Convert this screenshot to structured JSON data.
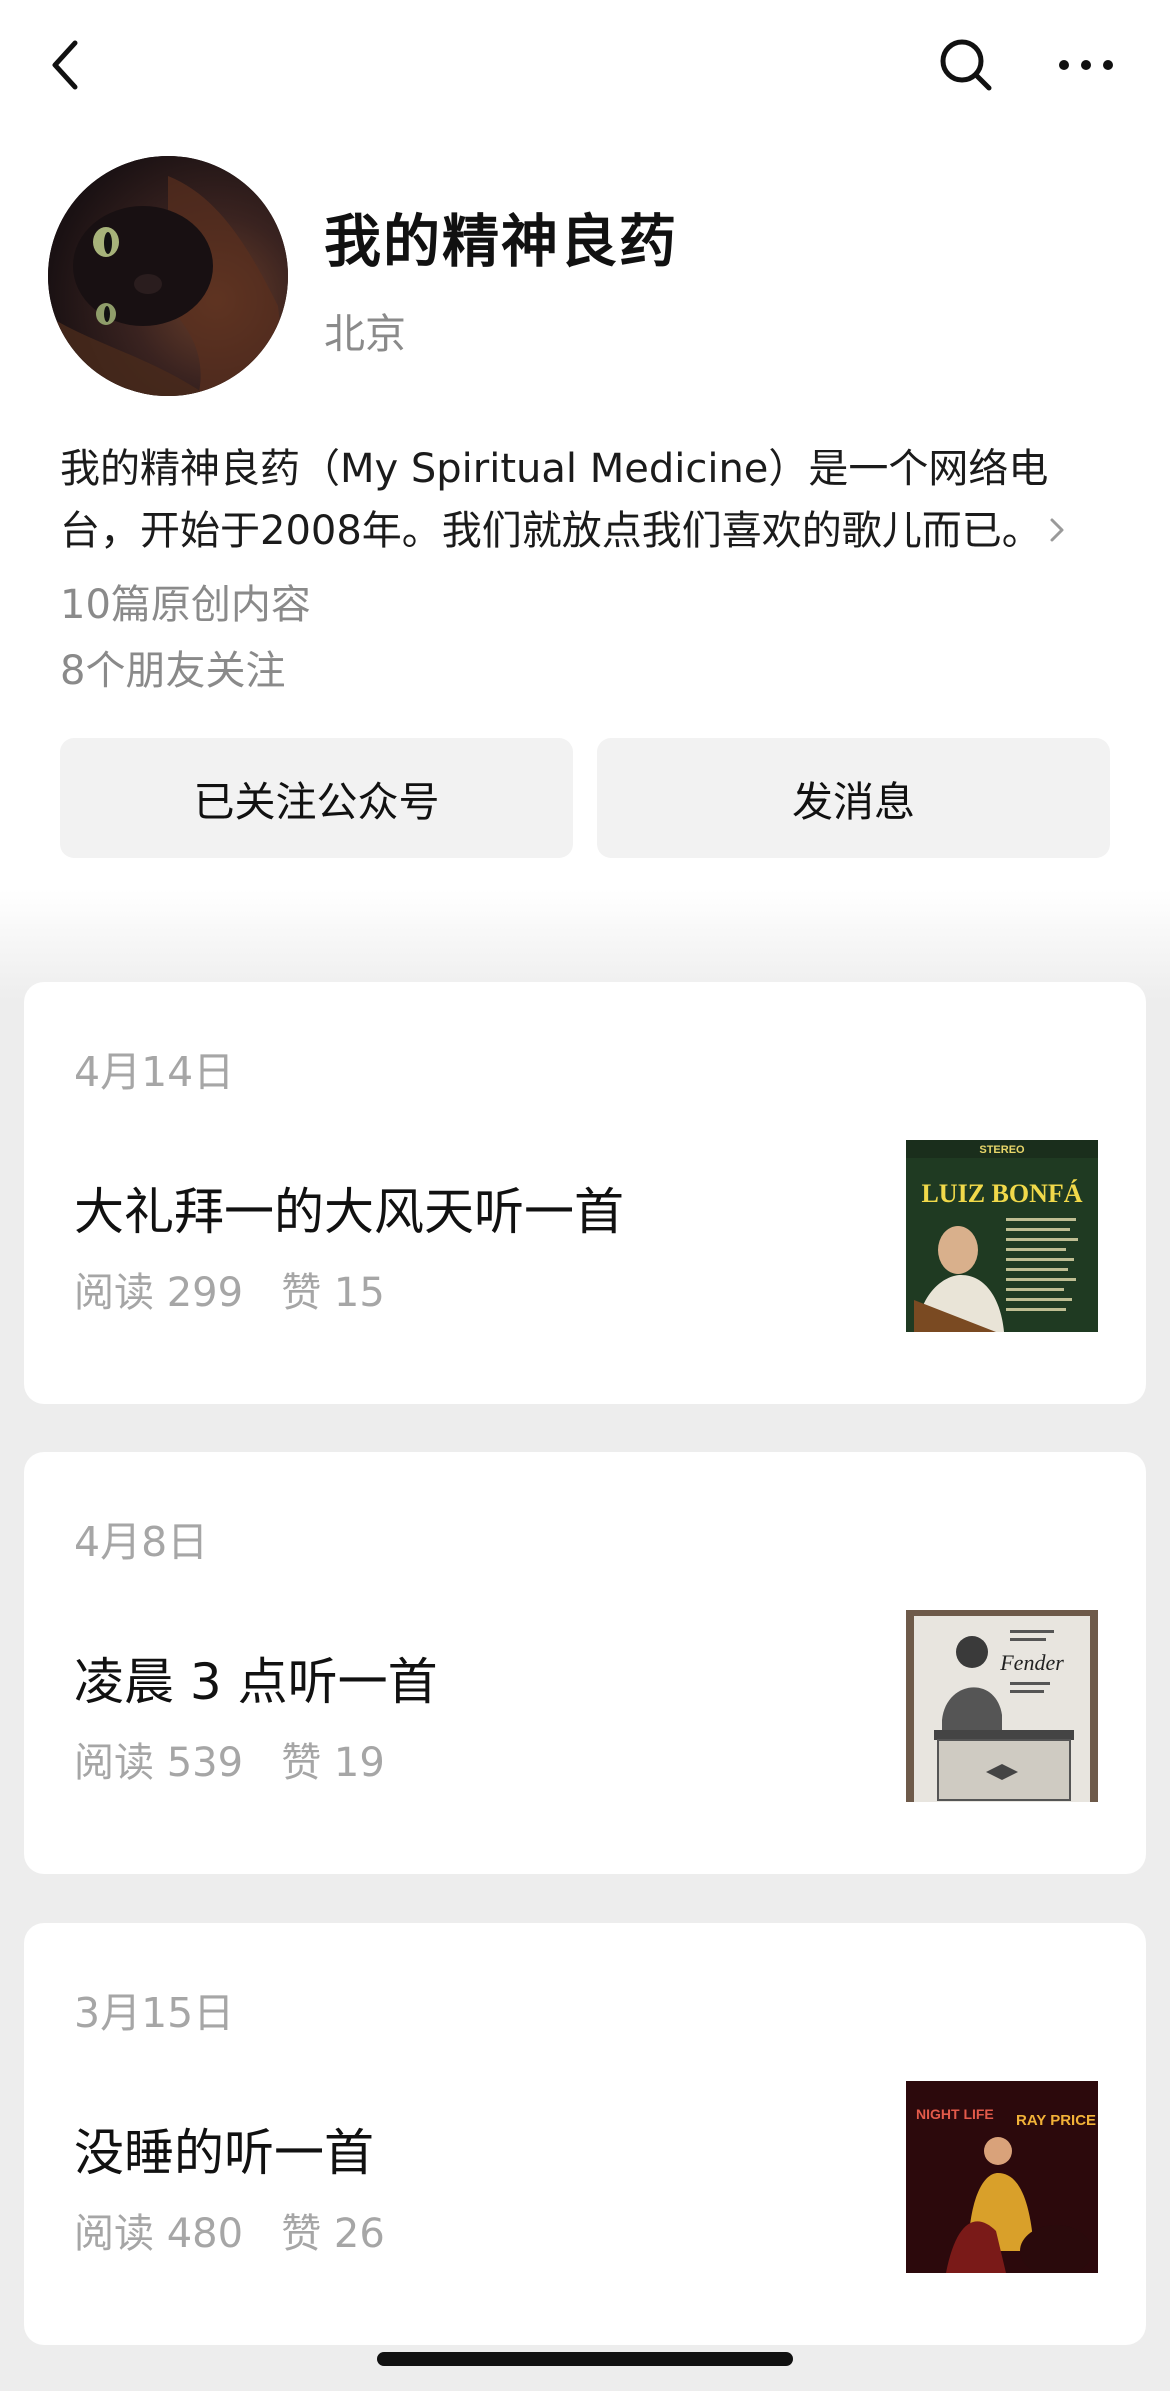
{
  "header": {
    "back_icon": "chevron-left-icon",
    "search_icon": "search-icon",
    "more_icon": "more-dots-icon"
  },
  "profile": {
    "name": "我的精神良药",
    "location": "北京",
    "description": "我的精神良药（My Spiritual Medicine）是一个网络电台，开始于2008年。我们就放点我们喜欢的歌儿而已。",
    "original_count": "10篇原创内容",
    "friends_following": "8个朋友关注",
    "follow_button": "已关注公众号",
    "message_button": "发消息"
  },
  "articles": [
    {
      "date": "4月14日",
      "title": "大礼拜一的大风天听一首",
      "meta": "阅读 299   赞 15",
      "thumb": {
        "top_text": "STEREO",
        "title_text": "LUIZ BONFÁ"
      }
    },
    {
      "date": "4月8日",
      "title": "凌晨 3 点听一首",
      "meta": "阅读 539   赞 19",
      "thumb": {
        "title_text": "Fender"
      }
    },
    {
      "date": "3月15日",
      "title": "没睡的听一首",
      "meta": "阅读 480   赞 26",
      "thumb": {
        "left_text": "NIGHT LIFE",
        "right_text": "RAY PRICE"
      }
    }
  ]
}
